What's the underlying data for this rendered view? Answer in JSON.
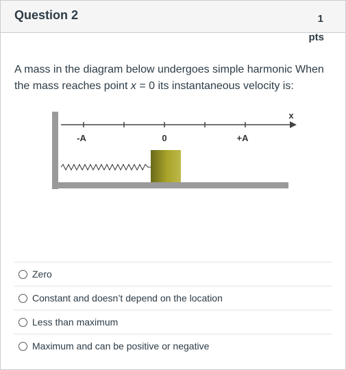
{
  "question": {
    "title": "Question 2",
    "points_value": "1",
    "points_unit": "pts",
    "text_before": "A mass in the diagram below undergoes simple harmonic When the mass reaches point ",
    "text_var": "x",
    "text_after": " = 0 its instantaneous velocity is:"
  },
  "diagram": {
    "axis_label": "x",
    "labels": [
      "-A",
      "0",
      "+A"
    ]
  },
  "answers": [
    {
      "label": "Zero"
    },
    {
      "label": "Constant and doesn’t depend on the location"
    },
    {
      "label": "Less than maximum"
    },
    {
      "label": "Maximum and can be positive or negative"
    }
  ]
}
